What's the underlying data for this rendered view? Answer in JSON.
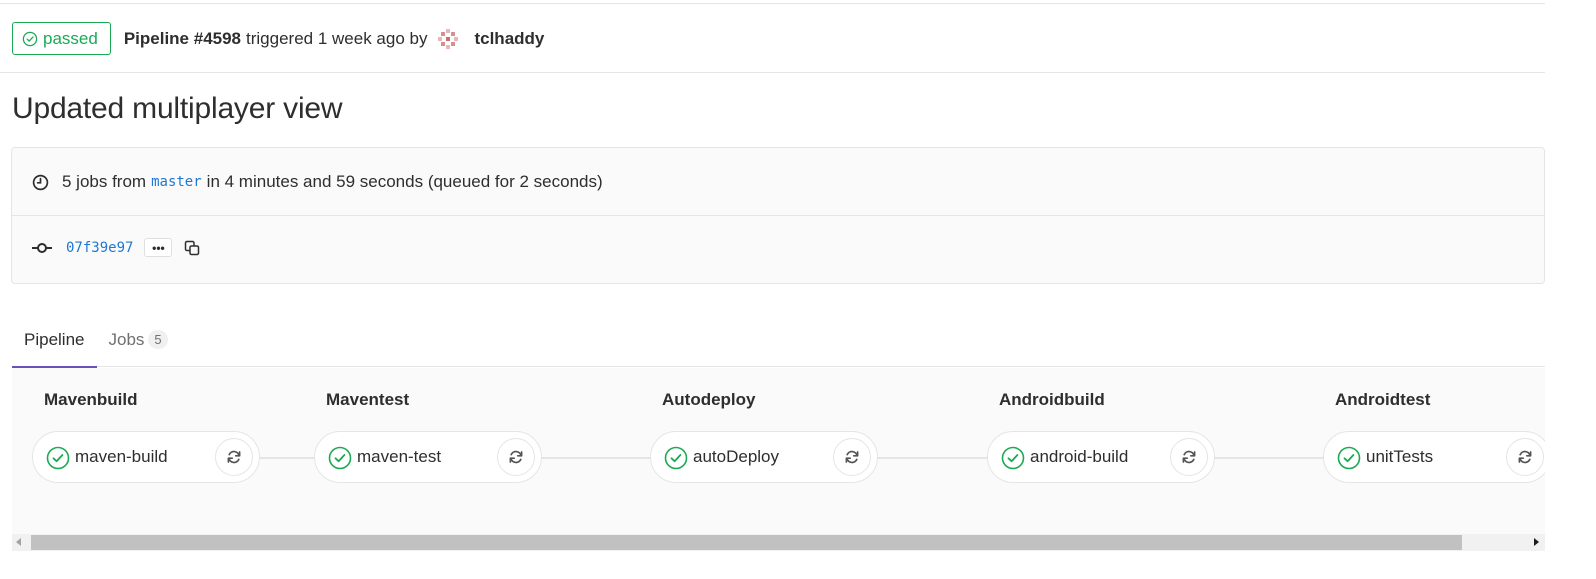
{
  "header": {
    "status_label": "passed",
    "pipeline_id": "Pipeline #4598",
    "triggered_text": "triggered 1 week ago by",
    "author": "tclhaddy"
  },
  "title": "Updated multiplayer view",
  "info": {
    "jobs_prefix": "5 jobs from",
    "branch": "master",
    "jobs_suffix": "in 4 minutes and 59 seconds (queued for 2 seconds)",
    "commit_sha": "07f39e97",
    "ellipsis": "•••"
  },
  "tabs": [
    {
      "label": "Pipeline",
      "active": true
    },
    {
      "label": "Jobs",
      "count": "5",
      "active": false
    }
  ],
  "stages": [
    {
      "title": "Mavenbuild",
      "job": "maven-build",
      "status": "passed"
    },
    {
      "title": "Maventest",
      "job": "maven-test",
      "status": "passed"
    },
    {
      "title": "Autodeploy",
      "job": "autoDeploy",
      "status": "passed"
    },
    {
      "title": "Androidbuild",
      "job": "android-build",
      "status": "passed"
    },
    {
      "title": "Androidtest",
      "job": "unitTests",
      "status": "passed"
    }
  ],
  "colors": {
    "success": "#1aaa55",
    "link": "#1f78d1",
    "tab_active": "#6b4fbb"
  },
  "icons": {
    "status": "check-circle-icon",
    "clock": "clock-icon",
    "commit": "commit-icon",
    "copy": "copy-icon",
    "retry": "retry-icon"
  }
}
